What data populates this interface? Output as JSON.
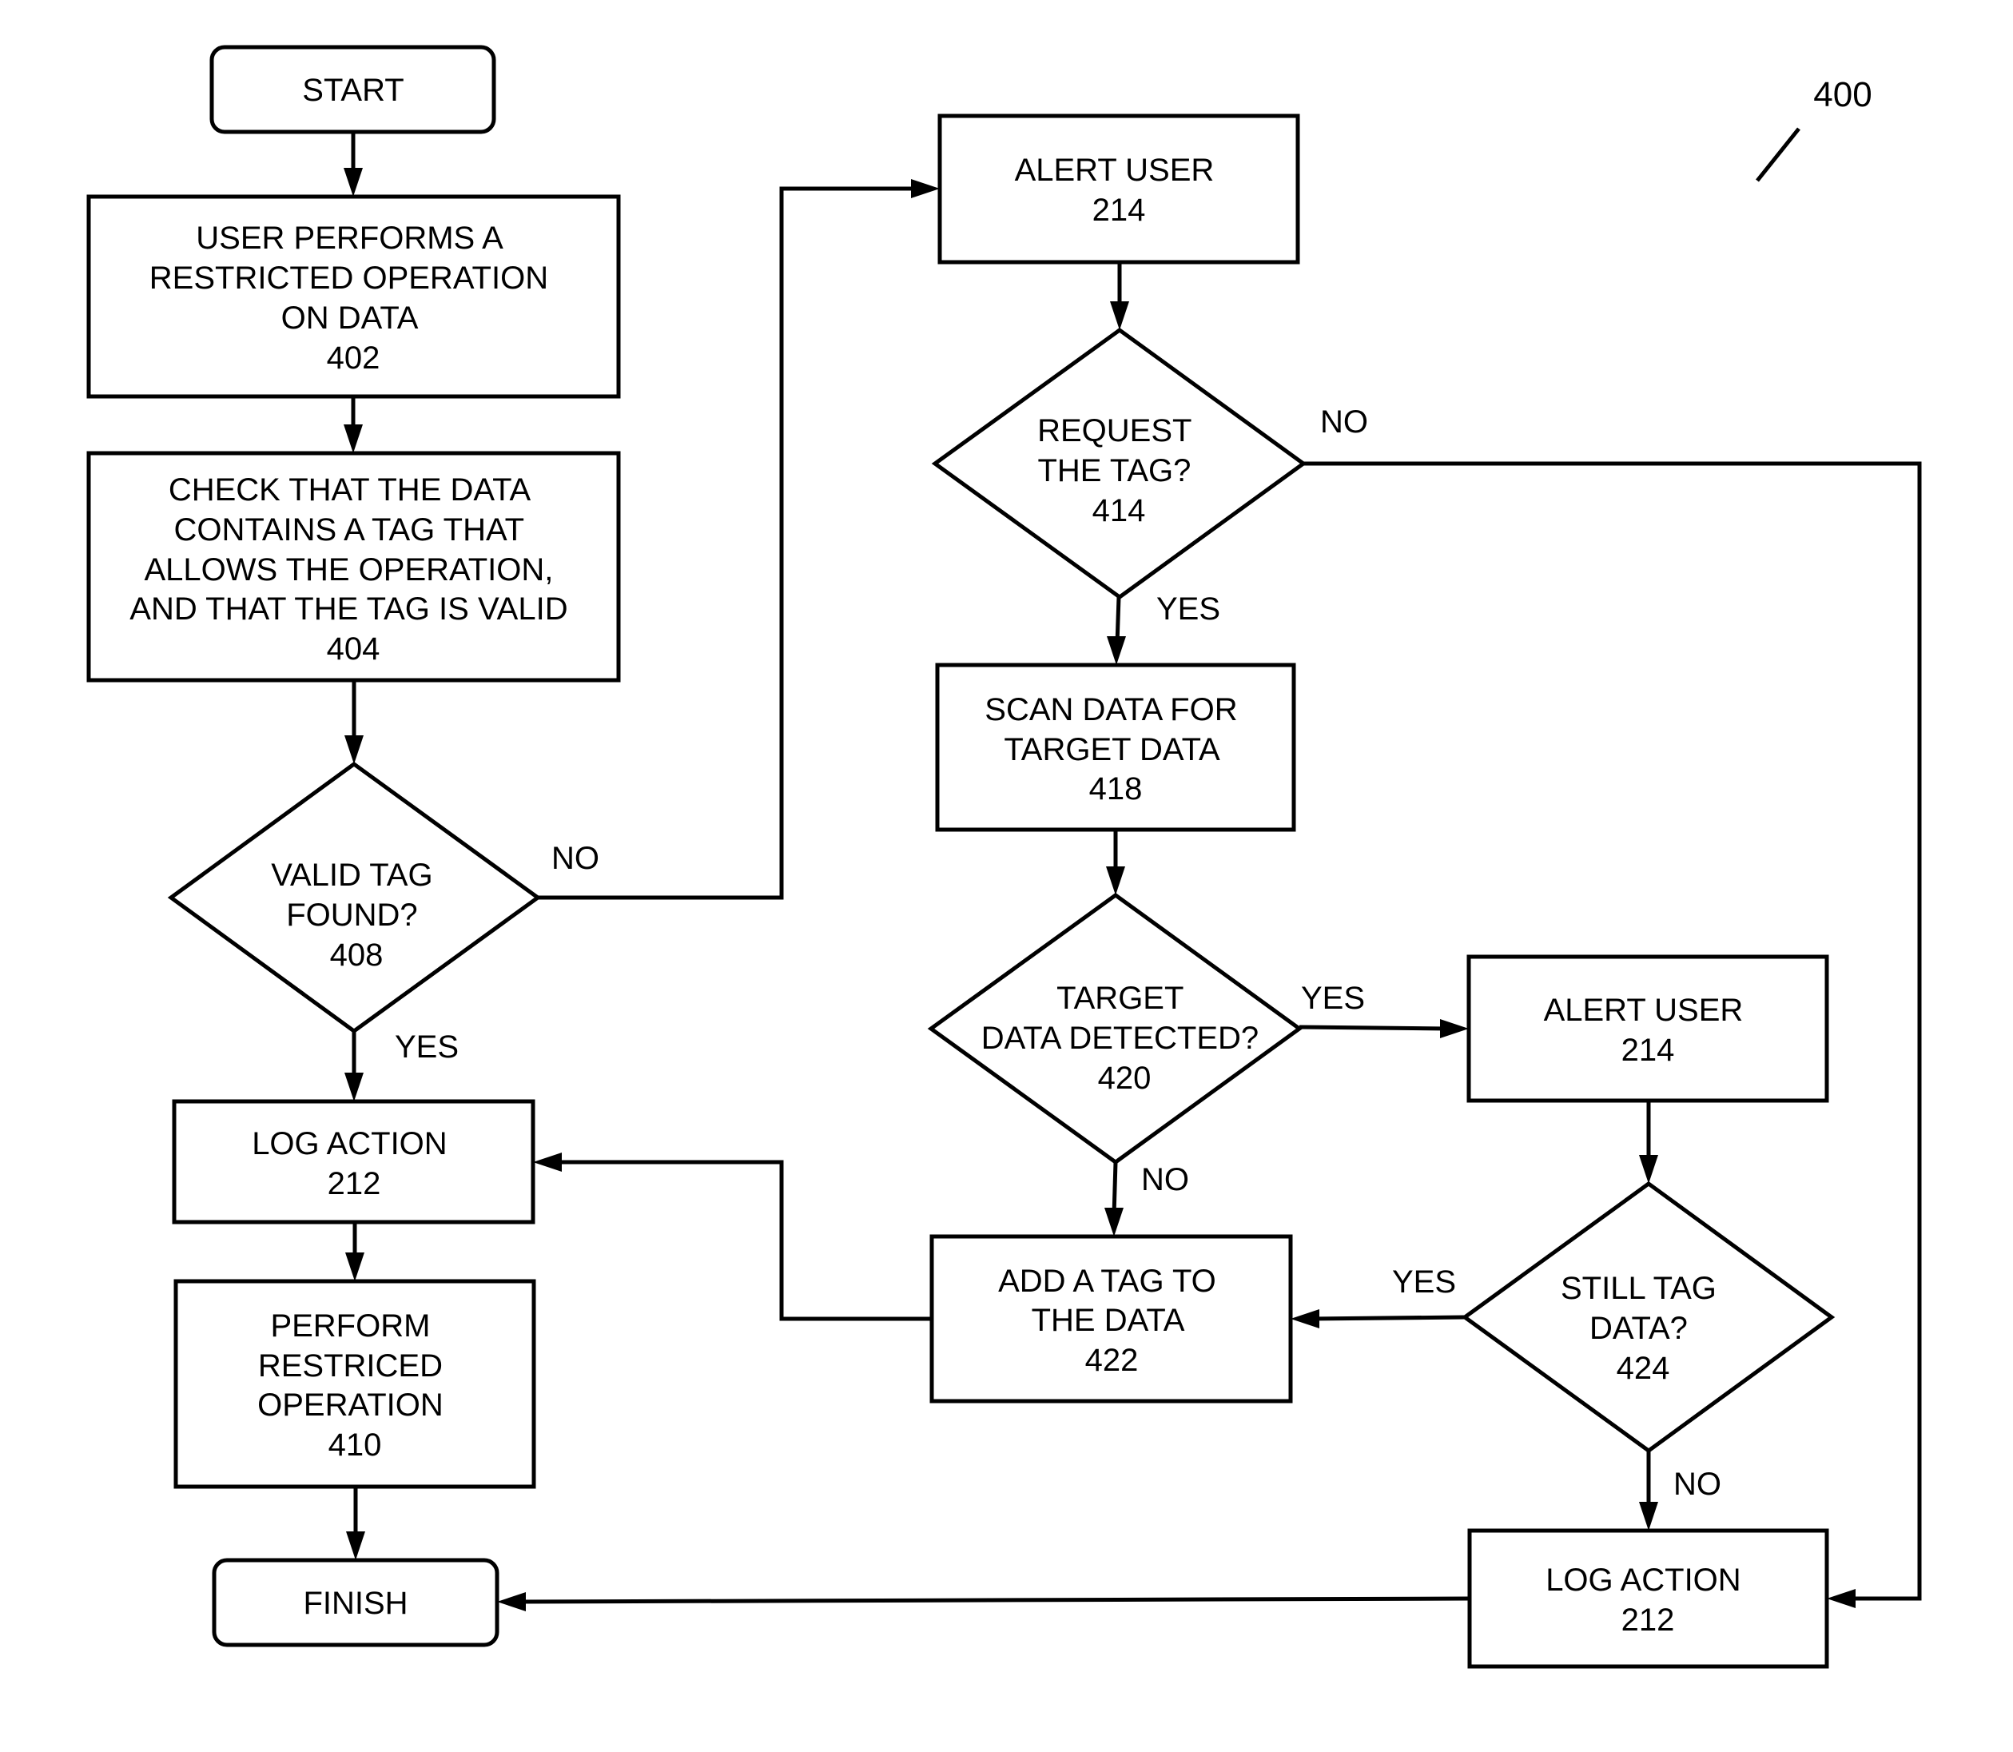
{
  "figure": {
    "reference": "400",
    "type": "flowchart"
  },
  "nodes": {
    "start": {
      "kind": "terminal",
      "lines": [
        "START"
      ]
    },
    "n402": {
      "kind": "process",
      "lines": [
        "USER PERFORMS A",
        "RESTRICTED OPERATION",
        "ON DATA",
        "402"
      ]
    },
    "n404": {
      "kind": "process",
      "lines": [
        "CHECK THAT THE DATA",
        "CONTAINS A TAG THAT",
        "ALLOWS THE OPERATION,",
        "AND THAT THE TAG IS VALID",
        "404"
      ]
    },
    "n408": {
      "kind": "decision",
      "lines": [
        "VALID TAG",
        "FOUND?",
        "408"
      ]
    },
    "n212a": {
      "kind": "process",
      "lines": [
        "LOG ACTION",
        "212"
      ]
    },
    "n410": {
      "kind": "process",
      "lines": [
        "PERFORM",
        "RESTRICED",
        "OPERATION",
        "410"
      ]
    },
    "finish": {
      "kind": "terminal",
      "lines": [
        "FINISH"
      ]
    },
    "n214a": {
      "kind": "process",
      "lines": [
        "ALERT USER",
        "214"
      ]
    },
    "n414": {
      "kind": "decision",
      "lines": [
        "REQUEST",
        "THE TAG?",
        "414"
      ]
    },
    "n418": {
      "kind": "process",
      "lines": [
        "SCAN DATA FOR",
        "TARGET DATA",
        "418"
      ]
    },
    "n420": {
      "kind": "decision",
      "lines": [
        "TARGET",
        "DATA DETECTED?",
        "420"
      ]
    },
    "n214b": {
      "kind": "process",
      "lines": [
        "ALERT USER",
        "214"
      ]
    },
    "n422": {
      "kind": "process",
      "lines": [
        "ADD A TAG TO",
        "THE DATA",
        "422"
      ]
    },
    "n424": {
      "kind": "decision",
      "lines": [
        "STILL TAG",
        "DATA?",
        "424"
      ]
    },
    "n212b": {
      "kind": "process",
      "lines": [
        "LOG ACTION",
        "212"
      ]
    }
  },
  "edges": [
    {
      "from": "start",
      "to": "n402",
      "label": ""
    },
    {
      "from": "n402",
      "to": "n404",
      "label": ""
    },
    {
      "from": "n404",
      "to": "n408",
      "label": ""
    },
    {
      "from": "n408",
      "to": "n214a",
      "label": "NO"
    },
    {
      "from": "n408",
      "to": "n212a",
      "label": "YES"
    },
    {
      "from": "n212a",
      "to": "n410",
      "label": ""
    },
    {
      "from": "n410",
      "to": "finish",
      "label": ""
    },
    {
      "from": "n214a",
      "to": "n414",
      "label": ""
    },
    {
      "from": "n414",
      "to": "n212b",
      "label": "NO"
    },
    {
      "from": "n414",
      "to": "n418",
      "label": "YES"
    },
    {
      "from": "n418",
      "to": "n420",
      "label": ""
    },
    {
      "from": "n420",
      "to": "n214b",
      "label": "YES"
    },
    {
      "from": "n420",
      "to": "n422",
      "label": "NO"
    },
    {
      "from": "n214b",
      "to": "n424",
      "label": ""
    },
    {
      "from": "n424",
      "to": "n422",
      "label": "YES"
    },
    {
      "from": "n424",
      "to": "n212b",
      "label": "NO"
    },
    {
      "from": "n422",
      "to": "n212a",
      "label": ""
    },
    {
      "from": "n212b",
      "to": "finish",
      "label": ""
    }
  ],
  "labels": {
    "yes": "YES",
    "no": "NO"
  }
}
